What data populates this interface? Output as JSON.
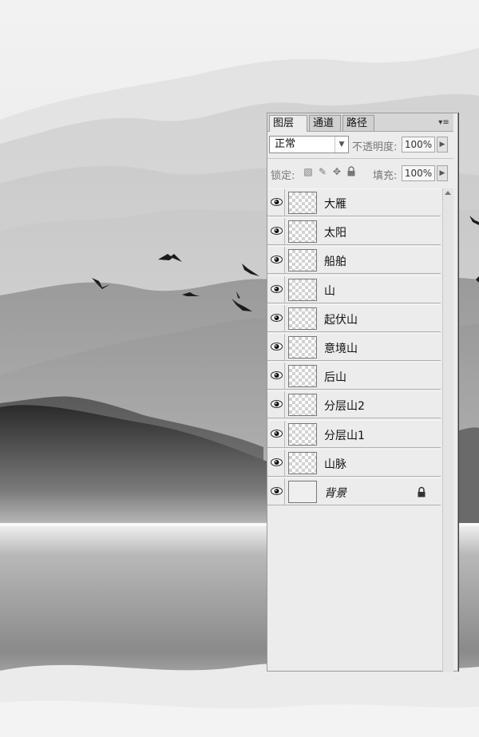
{
  "tabs": {
    "layers": "图层",
    "layers_close": "×",
    "channels": "通道",
    "paths": "路径",
    "menu_icon": "▾≡"
  },
  "blend": {
    "mode": "正常",
    "opacity_label": "不透明度:",
    "opacity": "100%"
  },
  "lock": {
    "label": "锁定:",
    "fill_label": "填充:",
    "fill": "100%"
  },
  "layers": [
    {
      "name": "大雁",
      "visible": true
    },
    {
      "name": "太阳",
      "visible": true
    },
    {
      "name": "船舶",
      "visible": true
    },
    {
      "name": "山",
      "visible": true
    },
    {
      "name": "起伏山",
      "visible": true
    },
    {
      "name": "意境山",
      "visible": true
    },
    {
      "name": "后山",
      "visible": true
    },
    {
      "name": "分层山2",
      "visible": true
    },
    {
      "name": "分层山1",
      "visible": true
    },
    {
      "name": "山脉",
      "visible": true
    },
    {
      "name": "背景",
      "visible": true,
      "locked": true
    }
  ],
  "icons": [
    "eye-icon",
    "lock-icon",
    "move-icon",
    "brush-icon",
    "pixel-lock-icon",
    "panel-menu-icon",
    "scroll-up-icon"
  ]
}
